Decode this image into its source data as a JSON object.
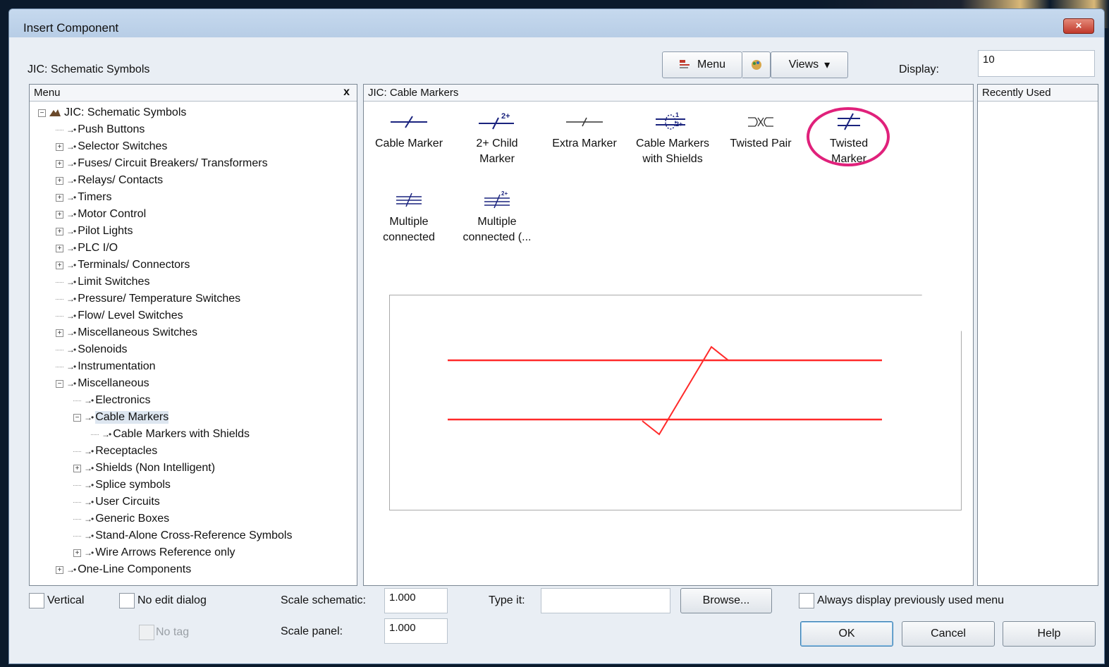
{
  "window": {
    "title": "Insert Component",
    "close_icon": "×"
  },
  "toolbar": {
    "library_label": "JIC: Schematic Symbols",
    "menu_button": "Menu",
    "views_button": "Views",
    "views_arrow": "▾",
    "display_label": "Display:",
    "display_value": "10"
  },
  "menu_panel": {
    "header": "Menu",
    "close_icon": "x",
    "tree": [
      {
        "label": "JIC: Schematic Symbols",
        "indent": 0,
        "expander": "−",
        "root": true
      },
      {
        "label": "Push Buttons",
        "indent": 1,
        "expander": ""
      },
      {
        "label": "Selector Switches",
        "indent": 1,
        "expander": "+"
      },
      {
        "label": "Fuses/ Circuit Breakers/ Transformers",
        "indent": 1,
        "expander": "+"
      },
      {
        "label": "Relays/ Contacts",
        "indent": 1,
        "expander": "+"
      },
      {
        "label": "Timers",
        "indent": 1,
        "expander": "+"
      },
      {
        "label": "Motor Control",
        "indent": 1,
        "expander": "+"
      },
      {
        "label": "Pilot Lights",
        "indent": 1,
        "expander": "+"
      },
      {
        "label": "PLC I/O",
        "indent": 1,
        "expander": "+"
      },
      {
        "label": "Terminals/ Connectors",
        "indent": 1,
        "expander": "+"
      },
      {
        "label": "Limit Switches",
        "indent": 1,
        "expander": ""
      },
      {
        "label": "Pressure/ Temperature Switches",
        "indent": 1,
        "expander": ""
      },
      {
        "label": "Flow/ Level Switches",
        "indent": 1,
        "expander": ""
      },
      {
        "label": "Miscellaneous Switches",
        "indent": 1,
        "expander": "+"
      },
      {
        "label": "Solenoids",
        "indent": 1,
        "expander": ""
      },
      {
        "label": "Instrumentation",
        "indent": 1,
        "expander": ""
      },
      {
        "label": "Miscellaneous",
        "indent": 1,
        "expander": "−"
      },
      {
        "label": "Electronics",
        "indent": 2,
        "expander": ""
      },
      {
        "label": "Cable Markers",
        "indent": 2,
        "expander": "−",
        "selected": true
      },
      {
        "label": "Cable Markers with Shields",
        "indent": 3,
        "expander": ""
      },
      {
        "label": "Receptacles",
        "indent": 2,
        "expander": ""
      },
      {
        "label": "Shields (Non Intelligent)",
        "indent": 2,
        "expander": "+"
      },
      {
        "label": "Splice symbols",
        "indent": 2,
        "expander": ""
      },
      {
        "label": "User Circuits",
        "indent": 2,
        "expander": ""
      },
      {
        "label": "Generic Boxes",
        "indent": 2,
        "expander": ""
      },
      {
        "label": "Stand-Alone Cross-Reference Symbols",
        "indent": 2,
        "expander": ""
      },
      {
        "label": "Wire Arrows Reference only",
        "indent": 2,
        "expander": "+"
      },
      {
        "label": "One-Line Components",
        "indent": 1,
        "expander": "+"
      }
    ]
  },
  "cable_panel": {
    "header": "JIC: Cable Markers",
    "symbols": [
      {
        "label_1": "Cable Marker",
        "label_2": "",
        "icon": "cable-marker-icon"
      },
      {
        "label_1": "2+ Child",
        "label_2": "Marker",
        "icon": "child-marker-icon"
      },
      {
        "label_1": "Extra Marker",
        "label_2": "",
        "icon": "extra-marker-icon"
      },
      {
        "label_1": "Cable Markers",
        "label_2": "with Shields",
        "icon": "shield-marker-icon"
      },
      {
        "label_1": "Twisted Pair",
        "label_2": "",
        "icon": "twisted-pair-icon"
      },
      {
        "label_1": "Twisted",
        "label_2": "Marker",
        "icon": "twisted-marker-icon"
      },
      {
        "label_1": "Multiple",
        "label_2": "connected",
        "icon": "multiple-connected-icon"
      },
      {
        "label_1": "Multiple",
        "label_2": "connected (...",
        "icon": "multiple-connected-child-icon"
      }
    ],
    "child_badge": "2+",
    "shield_badge_1": "1",
    "shield_badge_2": "2+",
    "preview_color": "#ff2a2a",
    "highlight_color": "#e0217b"
  },
  "recent_panel": {
    "header": "Recently Used"
  },
  "bottom": {
    "vertical_label": "Vertical",
    "no_edit_label": "No edit dialog",
    "no_tag_label": "No tag",
    "scale_schematic_label": "Scale schematic:",
    "scale_schematic_value": "1.000",
    "scale_panel_label": "Scale panel:",
    "scale_panel_value": "1.000",
    "type_it_label": "Type it:",
    "type_it_value": "",
    "browse_button": "Browse...",
    "always_display_label": "Always display previously used menu",
    "ok_button": "OK",
    "cancel_button": "Cancel",
    "help_button": "Help"
  }
}
